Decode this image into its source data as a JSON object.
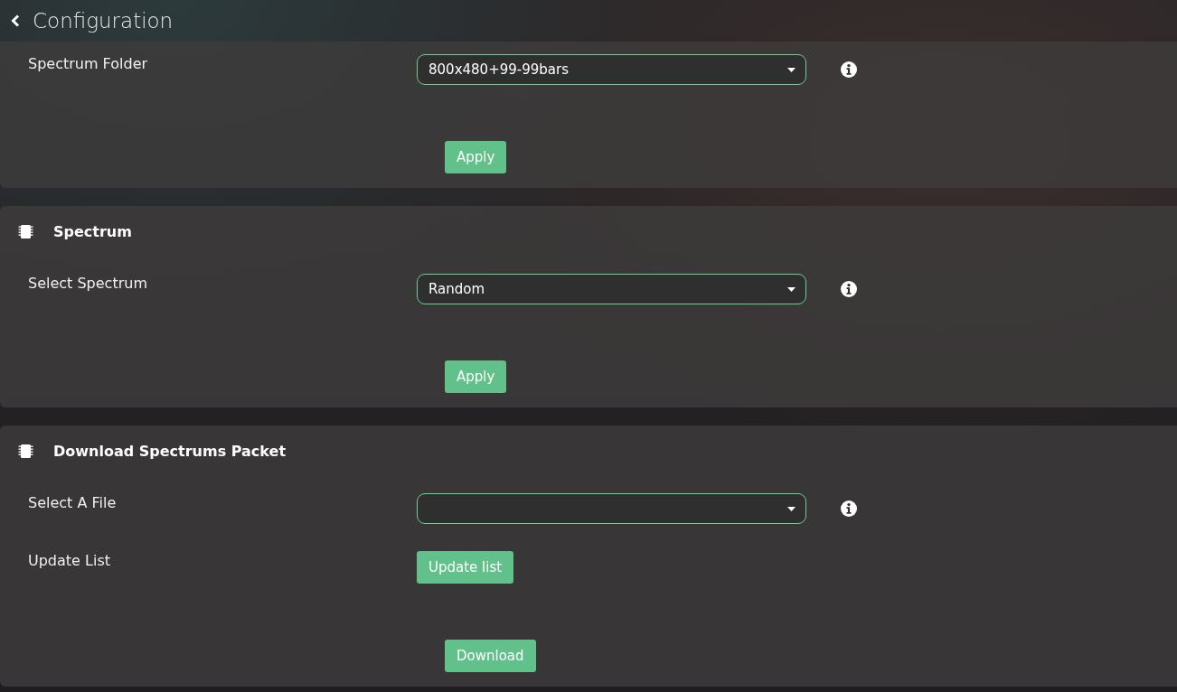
{
  "header": {
    "title": "Configuration"
  },
  "panels": [
    {
      "rows": [
        {
          "kind": "select",
          "label": "Spectrum Folder",
          "value": "800x480+99-99bars"
        },
        {
          "kind": "action",
          "button": "Apply"
        }
      ]
    },
    {
      "title": "Spectrum",
      "rows": [
        {
          "kind": "select",
          "label": "Select Spectrum",
          "value": "Random"
        },
        {
          "kind": "action",
          "button": "Apply"
        }
      ]
    },
    {
      "title": "Download Spectrums Packet",
      "rows": [
        {
          "kind": "select",
          "label": "Select A File"
        },
        {
          "kind": "button",
          "label": "Update List",
          "button": "Update list"
        },
        {
          "kind": "action",
          "button": "Download"
        }
      ]
    }
  ]
}
